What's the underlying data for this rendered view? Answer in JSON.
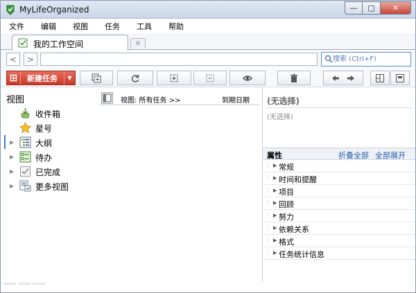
{
  "window": {
    "title": "MyLifeOrganized",
    "minimize": "—",
    "maximize": "▢",
    "close": "✕"
  },
  "menu": [
    "文件",
    "编辑",
    "视图",
    "任务",
    "工具",
    "帮助"
  ],
  "workspace_tab": {
    "label": "我的工作空间"
  },
  "nav": {
    "back": "<",
    "forward": ">",
    "search_placeholder": "搜索 (Ctrl+F)"
  },
  "toolbar": {
    "new_task_label": "新建任务",
    "new_task_plus": "⊞",
    "new_task_dropdown": "▼"
  },
  "left_pane": {
    "title": "视图",
    "items": [
      {
        "label": "收件箱",
        "icon": "inbox-icon",
        "has_arrow": false
      },
      {
        "label": "星号",
        "icon": "star-icon",
        "has_arrow": false
      },
      {
        "label": "大纲",
        "icon": "outline-icon",
        "has_arrow": true
      },
      {
        "label": "待办",
        "icon": "todo-icon",
        "has_arrow": true
      },
      {
        "label": "已完成",
        "icon": "completed-icon",
        "has_arrow": true
      },
      {
        "label": "更多视图",
        "icon": "more-views-icon",
        "has_arrow": true
      }
    ]
  },
  "middle": {
    "view_label": "视图: 所有任务 >>",
    "due_label": "到期日期"
  },
  "right_pane": {
    "no_selection_title": "(无选择)",
    "no_selection_text": "(无选择)",
    "properties_label": "属性",
    "collapse_all": "折叠全部",
    "expand_all": "全部展开",
    "sections": [
      "常规",
      "时间和提醒",
      "项目",
      "回顾",
      "努力",
      "依赖关系",
      "格式",
      "任务统计信息"
    ]
  },
  "colors": {
    "accent_red": "#d64a38",
    "link_blue": "#2a5db0",
    "selection_blue": "#3f7fd6"
  }
}
